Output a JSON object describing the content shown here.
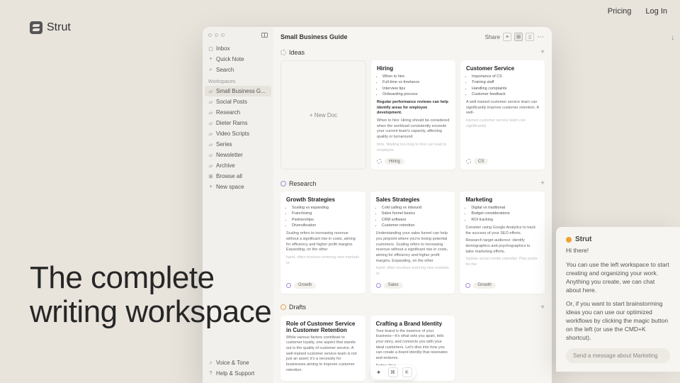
{
  "top_nav": {
    "pricing": "Pricing",
    "login": "Log In"
  },
  "brand": "Strut",
  "hero_line1": "The complete",
  "hero_line2": "writing workspace",
  "sidebar": {
    "inbox": "Inbox",
    "quick_note": "Quick Note",
    "search": "Search",
    "workspaces_hdr": "Workspaces",
    "items": [
      "Small Business G...",
      "Social Posts",
      "Research",
      "Dieter Rams",
      "Video Scripts",
      "Series",
      "Newsletter",
      "Archive"
    ],
    "browse_all": "Browse all",
    "new_space": "New space",
    "voice_tone": "Voice & Tone",
    "help": "Help & Support"
  },
  "header": {
    "title": "Small Business Guide",
    "share": "Share"
  },
  "sections": {
    "ideas": {
      "title": "Ideas",
      "new_doc": "+  New Doc",
      "cards": [
        {
          "title": "Hiring",
          "bullets": [
            "When to hire",
            "Full-time vs freelance",
            "Interview tips",
            "Onboarding process"
          ],
          "bold": "Regular performance reviews can help identify areas for employee development.",
          "text": "When to hire: Hiring should be considered when the workload consistently exceeds your current team's capacity, affecting quality or turnaround",
          "fade": "time. Waiting too long to hire can lead to employee",
          "tag": "Hiring"
        },
        {
          "title": "Customer Service",
          "bullets": [
            "Importance of CS",
            "Training staff",
            "Handling complaints",
            "Customer feedback"
          ],
          "text": "A well-trained customer service team can significantly improve customer retention. A well-",
          "fade": "trained customer service team can significantly",
          "tag": "CS"
        }
      ]
    },
    "research": {
      "title": "Research",
      "cards": [
        {
          "title": "Growth Strategies",
          "bullets": [
            "Scaling vs expanding",
            "Franchising",
            "Partnerships",
            "Diversification"
          ],
          "text": "Scaling refers to increasing revenue without a significant rise in costs, aiming for efficiency and higher profit margins. Expanding, on the other",
          "fade": "hand, often involves entering new markets or",
          "tag": "Growth"
        },
        {
          "title": "Sales Strategies",
          "bullets": [
            "Cold calling vs inbound",
            "Sales funnel basics",
            "CRM software",
            "Customer retention"
          ],
          "text": "Understanding your sales funnel can help you pinpoint where you're losing potential customers. Scaling refers to increasing revenue without a significant rise in costs, aiming for efficiency and higher profit margins. Expanding, on the other",
          "fade": "hand, often involves entering new markets or",
          "tag": "Sales"
        },
        {
          "title": "Marketing",
          "bullets": [
            "Digital vs traditional",
            "Budget considerations",
            "ROI tracking"
          ],
          "text": "Consider using Google Analytics to track the success of your SEO efforts.",
          "text2": "Research target audience: identify demographics and psychographics to tailor marketing efforts.",
          "fade": "Update social media calendar: Plan posts for the",
          "tag": "Growth"
        }
      ]
    },
    "drafts": {
      "title": "Drafts",
      "cards": [
        {
          "title": "Role of Customer Service in Customer Retention",
          "text": "While various factors contribute to customer loyalty, one aspect that stands out is the quality of customer service. A well-trained customer service team is not just an asset; it's a necessity for businesses aiming to improve customer retention."
        },
        {
          "title": "Crafting a Brand Identity",
          "text": "Your brand is the essence of your business—it's what sets you apart, tells your story, and connects you with your ideal customers. Let's dive into how you can create a brand identity that resonates and endures.",
          "sub": "Define Your"
        }
      ]
    }
  },
  "toolbar": {
    "magic": "✦",
    "cmd": "⌘",
    "k": "K"
  },
  "chat": {
    "name": "Strut",
    "greeting": "Hi there!",
    "p1": "You can use the left workspace to start creating and organizing your work. Anything you create, we can chat about here.",
    "p2": "Or, if you want to start brainstorming ideas you can use our optimized workflows by clicking the magic button on the left (or use the CMD+K shortcut).",
    "placeholder": "Send a message about Marketing"
  }
}
